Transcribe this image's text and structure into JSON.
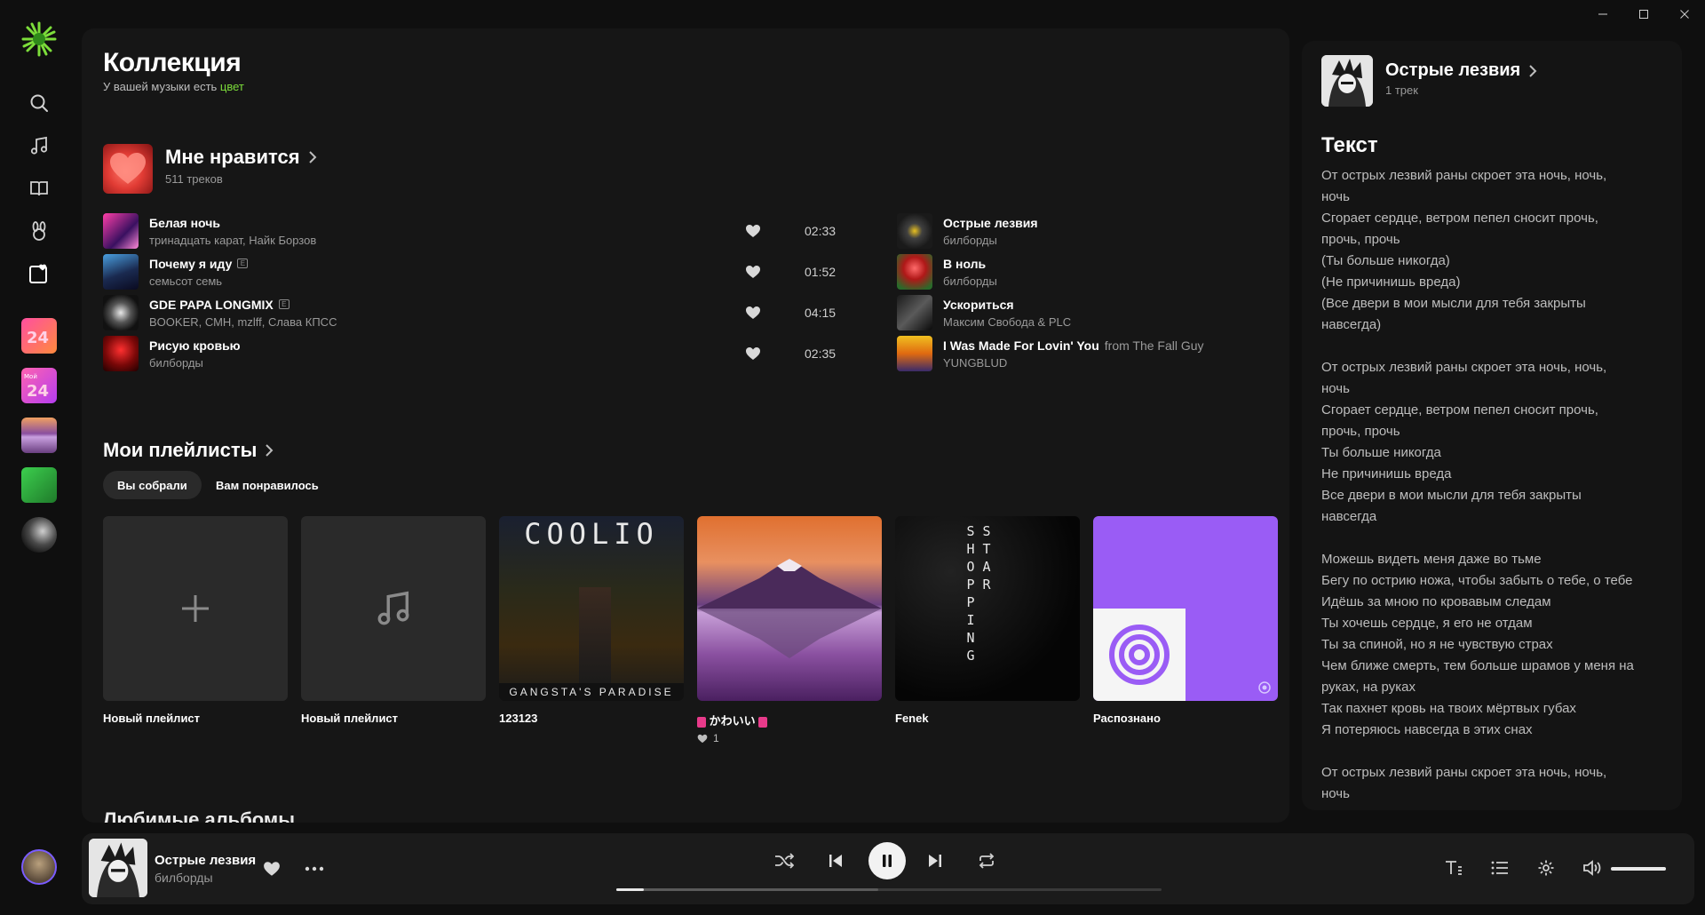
{
  "window": {
    "minimize": "—",
    "maximize": "☐",
    "close": "✕"
  },
  "nav": {
    "items": [
      {
        "name": "search"
      },
      {
        "name": "music"
      },
      {
        "name": "podcasts"
      },
      {
        "name": "kids"
      },
      {
        "name": "collection",
        "active": true
      }
    ]
  },
  "collection": {
    "title": "Коллекция",
    "subtitle_prefix": "У вашей музыки есть ",
    "subtitle_accent": "цвет",
    "liked": {
      "title": "Мне нравится",
      "count": "511 треков"
    },
    "tracks": [
      {
        "title": "Белая ночь",
        "artist": "тринадцать карат, Найк Борзов",
        "duration": "02:33",
        "explicit": false
      },
      {
        "title": "Почему я иду",
        "artist": "семьсот семь",
        "duration": "01:52",
        "explicit": true
      },
      {
        "title": "GDE PAPA LONGMIX",
        "artist": "BOOKER, СМН, mzlff, Слава КПСС",
        "duration": "04:15",
        "explicit": true
      },
      {
        "title": "Рисую кровью",
        "artist": "билборды",
        "duration": "02:35",
        "explicit": false
      }
    ],
    "tracks_right": [
      {
        "title": "Острые лезвия",
        "artist": "билборды",
        "from": ""
      },
      {
        "title": "В ноль",
        "artist": "билборды",
        "from": ""
      },
      {
        "title": "Ускориться",
        "artist": "Максим Свобода & PLC",
        "from": ""
      },
      {
        "title": "I Was Made For Lovin' You",
        "artist": "YUNGBLUD",
        "from": "from The Fall Guy"
      }
    ]
  },
  "playlists": {
    "title": "Мои плейлисты",
    "tabs": [
      "Вы собрали",
      "Вам понравилось"
    ],
    "cards": [
      {
        "title": "Новый плейлист"
      },
      {
        "title": "Новый плейлист"
      },
      {
        "title": "123123",
        "cover_text_top": "COOLIO",
        "cover_text_bottom": "GANGSTA'S PARADISE"
      },
      {
        "title": "かわいい",
        "likes": "1"
      },
      {
        "title": "Fenek",
        "cover_text": "STAR SHOPPING"
      },
      {
        "title": "Распознано"
      }
    ]
  },
  "favorites": {
    "title": "Любимые альбомы"
  },
  "lyrics": {
    "track_title": "Острые лезвия",
    "track_sub": "1 трек",
    "heading": "Текст",
    "lines": [
      "От острых лезвий раны скроет эта ночь, ночь,",
      "ночь",
      "Сгорает сердце, ветром пепел сносит прочь,",
      "прочь, прочь",
      "(Ты больше никогда)",
      "(Не причинишь вреда)",
      "(Все двери в мои мысли для тебя закрыты",
      "навсегда)",
      "",
      "От острых лезвий раны скроет эта ночь, ночь,",
      "ночь",
      "Сгорает сердце, ветром пепел сносит прочь,",
      "прочь, прочь",
      "Ты больше никогда",
      "Не причинишь вреда",
      "Все двери в мои мысли для тебя закрыты",
      "навсегда",
      "",
      "Можешь видеть меня даже во тьме",
      "Бегу по острию ножа, чтобы забыть о тебе, о тебе",
      "Идёшь за мною по кровавым следам",
      "Ты хочешь сердце, я его не отдам",
      "Ты за спиной, но я не чувствую страх",
      "Чем ближе смерть, тем больше шрамов у меня на",
      "руках, на руках",
      "Так пахнет кровь на твоих мёртвых губах",
      "Я потеряюсь навсегда в этих снах",
      "",
      "От острых лезвий раны скроет эта ночь, ночь,",
      "ночь"
    ]
  },
  "player": {
    "title": "Острые лезвия",
    "artist": "билборды",
    "progress": 0.05,
    "buffered": 0.48,
    "volume": 1.0
  },
  "colors": {
    "accent": "#7cdd3a",
    "background": "#0f0f0f",
    "panel": "#161616"
  }
}
